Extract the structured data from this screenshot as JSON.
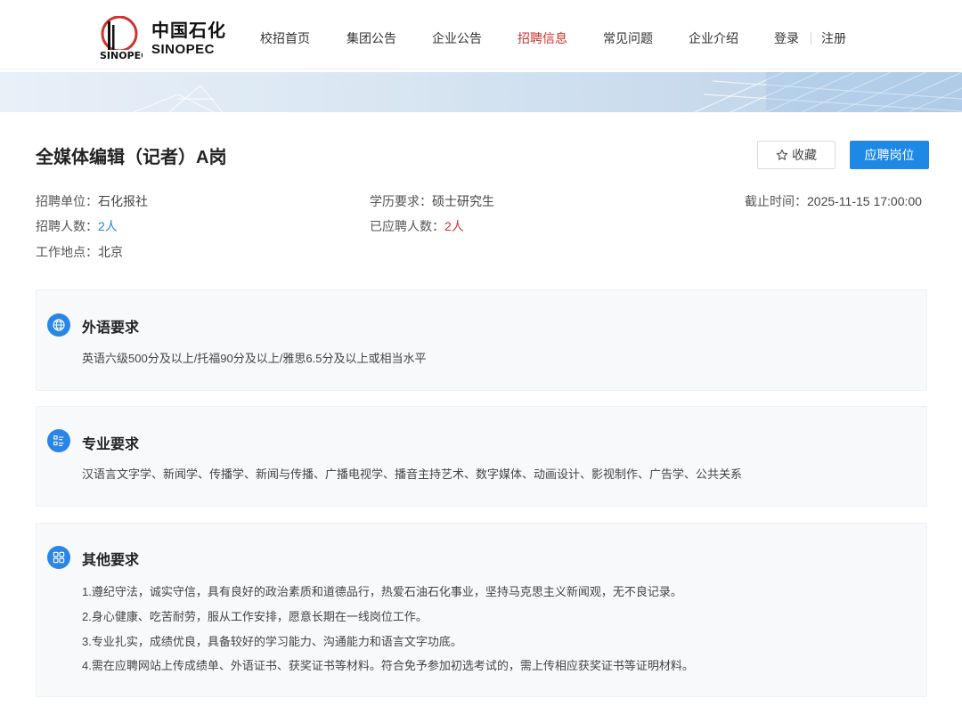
{
  "brand": {
    "logo_cn": "中国石化",
    "logo_en": "SINOPEC",
    "primary_color": "#1e88e5",
    "accent_red": "#d0322f"
  },
  "nav": {
    "items": [
      {
        "label": "校招首页",
        "active": false
      },
      {
        "label": "集团公告",
        "active": false
      },
      {
        "label": "企业公告",
        "active": false
      },
      {
        "label": "招聘信息",
        "active": true
      },
      {
        "label": "常见问题",
        "active": false
      },
      {
        "label": "企业介绍",
        "active": false
      }
    ],
    "login_label": "登录",
    "register_label": "注册"
  },
  "job": {
    "title": "全媒体编辑（记者）A岗",
    "favorite_label": "收藏",
    "apply_label": "应聘岗位",
    "unit_label": "招聘单位：",
    "unit_value": "石化报社",
    "education_label": "学历要求：",
    "education_value": "硕士研究生",
    "deadline_label": "截止时间：",
    "deadline_value": "2025-11-15 17:00:00",
    "headcount_label": "招聘人数：",
    "headcount_value": "2人",
    "applied_label": "已应聘人数：",
    "applied_value": "2人",
    "location_label": "工作地点：",
    "location_value": "北京"
  },
  "sections": {
    "language": {
      "title": "外语要求",
      "icon": "globe-icon",
      "body": "英语六级500分及以上/托福90分及以上/雅思6.5分及以上或相当水平"
    },
    "major": {
      "title": "专业要求",
      "icon": "list-icon",
      "body": "汉语言文字学、新闻学、传播学、新闻与传播、广播电视学、播音主持艺术、数字媒体、动画设计、影视制作、广告学、公共关系"
    },
    "other": {
      "title": "其他要求",
      "icon": "grid-icon",
      "lines": [
        "1.遵纪守法，诚实守信，具有良好的政治素质和道德品行，热爱石油石化事业，坚持马克思主义新闻观，无不良记录。",
        "2.身心健康、吃苦耐劳，服从工作安排，愿意长期在一线岗位工作。",
        "3.专业扎实，成绩优良，具备较好的学习能力、沟通能力和语言文字功底。",
        "4.需在应聘网站上传成绩单、外语证书、获奖证书等材料。符合免予参加初选考试的，需上传相应获奖证书等证明材料。"
      ]
    }
  }
}
